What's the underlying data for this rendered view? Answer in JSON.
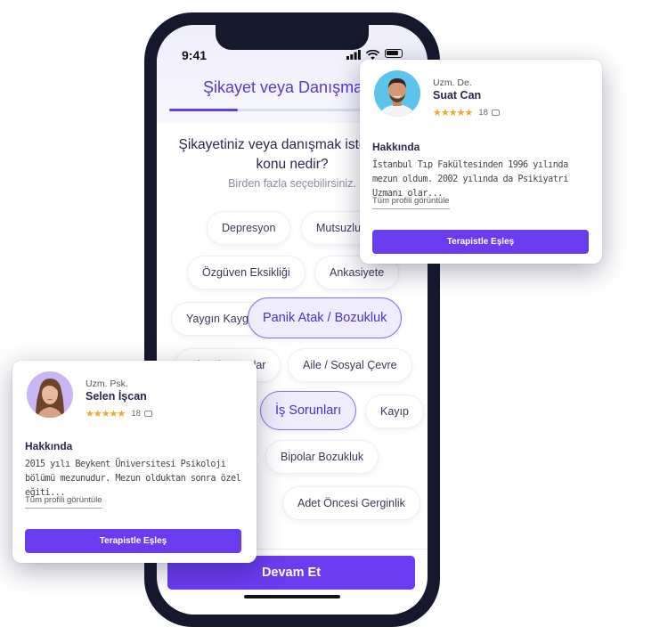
{
  "phone": {
    "status": {
      "time": "9:41"
    },
    "title": "Şikayet veya Danışma",
    "progress_fraction": 0.28,
    "question": "Şikayetiniz veya danışmak istediğiniz konu nedir?",
    "hint": "Birden fazla seçebilirsiniz.",
    "chips": [
      {
        "label": "Depresyon",
        "selected": false
      },
      {
        "label": "Mutsuzluk",
        "selected": false
      },
      {
        "label": "Özgüven Eksikliği",
        "selected": false
      },
      {
        "label": "Ankasiyete",
        "selected": false
      },
      {
        "label": "Yaygın Kaygı",
        "selected": false
      },
      {
        "label": "Panik Atak / Bozukluk",
        "selected": true
      },
      {
        "label": "Cinsel Sorunlar",
        "selected": false
      },
      {
        "label": "Aile / Sosyal Çevre",
        "selected": false
      },
      {
        "label": "İş Sorunları",
        "selected": true
      },
      {
        "label": "Kayıp",
        "selected": false
      },
      {
        "label": "Bipolar Bozukluk",
        "selected": false
      },
      {
        "label": "Adet Öncesi Gerginlik",
        "selected": false
      }
    ],
    "continue_label": "Devam Et"
  },
  "cards": [
    {
      "role": "Uzm. De.",
      "name": "Suat Can",
      "rating": 5,
      "stars": "★★★★★",
      "review_count": "18",
      "about_heading": "Hakkında",
      "about_text": "İstanbul Tıp Fakültesinden 1996 yılında mezun oldum. 2002 yılında da Psikiyatri Uzmanı olar...",
      "profile_link": "Tüm profili görüntüle",
      "match_label": "Terapistle Eşleş"
    },
    {
      "role": "Uzm. Psk.",
      "name": "Selen İşcan",
      "rating": 5,
      "stars": "★★★★★",
      "review_count": "18",
      "about_heading": "Hakkında",
      "about_text": "2015 yılı Beykent Üniversitesi Psikoloji bölümü mezunudur. Mezun olduktan sonra özel eğiti...",
      "profile_link": "Tüm profili görüntüle",
      "match_label": "Terapistle Eşleş"
    }
  ],
  "colors": {
    "accent": "#6a3cf0",
    "title": "#5b34d6",
    "star": "#f5a623",
    "phone": "#16182e"
  }
}
